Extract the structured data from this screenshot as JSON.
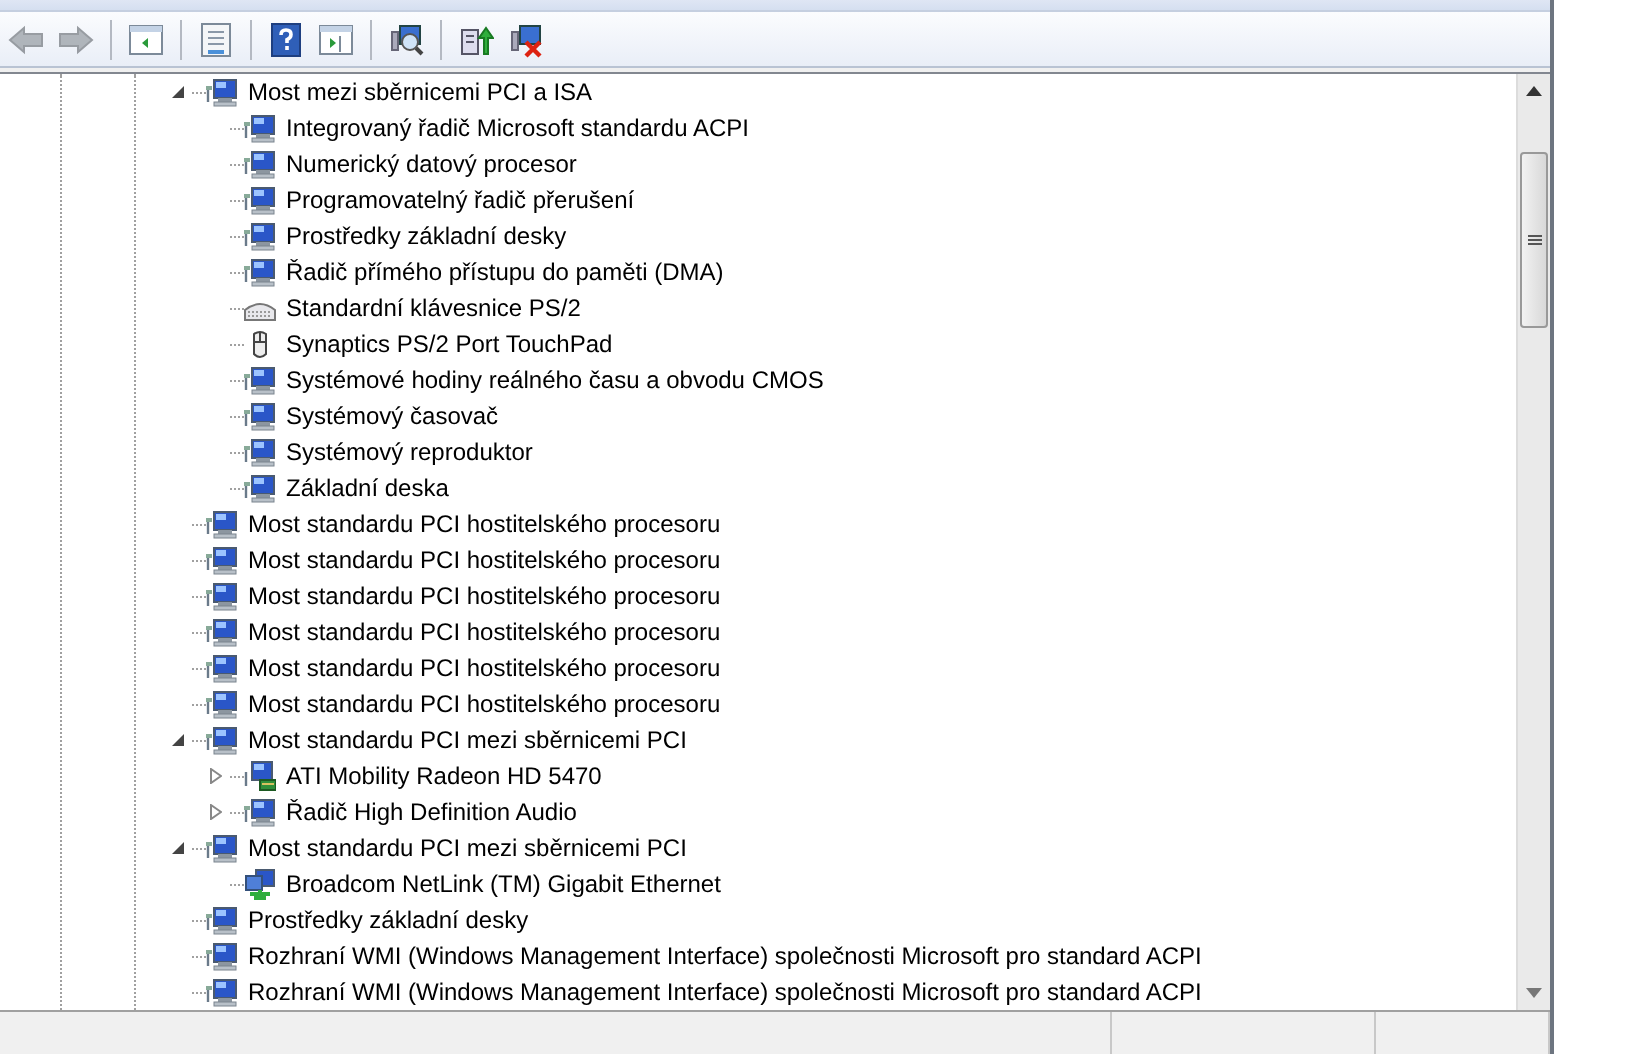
{
  "toolbar": {
    "buttons": [
      {
        "kind": "back",
        "disabled": true
      },
      {
        "kind": "forward",
        "disabled": true
      },
      {
        "kind": "sep"
      },
      {
        "kind": "pane",
        "disabled": false
      },
      {
        "kind": "sep"
      },
      {
        "kind": "properties",
        "disabled": false
      },
      {
        "kind": "sep"
      },
      {
        "kind": "help",
        "disabled": false
      },
      {
        "kind": "pane2",
        "disabled": false
      },
      {
        "kind": "sep"
      },
      {
        "kind": "scan",
        "disabled": false
      },
      {
        "kind": "sep"
      },
      {
        "kind": "update",
        "disabled": false
      },
      {
        "kind": "uninstall",
        "disabled": false
      }
    ]
  },
  "tree": [
    {
      "label": "Most mezi sběrnicemi PCI a ISA",
      "kind": "device",
      "expanded": true,
      "children": [
        {
          "label": "Integrovaný řadič Microsoft standardu ACPI",
          "kind": "device"
        },
        {
          "label": "Numerický datový procesor",
          "kind": "device"
        },
        {
          "label": "Programovatelný řadič přerušení",
          "kind": "device"
        },
        {
          "label": "Prostředky základní desky",
          "kind": "device"
        },
        {
          "label": "Řadič přímého přístupu do paměti (DMA)",
          "kind": "device"
        },
        {
          "label": "Standardní klávesnice PS/2",
          "kind": "keyboard"
        },
        {
          "label": "Synaptics PS/2 Port TouchPad",
          "kind": "mouse"
        },
        {
          "label": "Systémové hodiny reálného času a obvodu CMOS",
          "kind": "device"
        },
        {
          "label": "Systémový časovač",
          "kind": "device"
        },
        {
          "label": "Systémový reproduktor",
          "kind": "device"
        },
        {
          "label": "Základní deska",
          "kind": "device"
        }
      ]
    },
    {
      "label": "Most standardu PCI hostitelského procesoru",
      "kind": "device"
    },
    {
      "label": "Most standardu PCI hostitelského procesoru",
      "kind": "device"
    },
    {
      "label": "Most standardu PCI hostitelského procesoru",
      "kind": "device"
    },
    {
      "label": "Most standardu PCI hostitelského procesoru",
      "kind": "device"
    },
    {
      "label": "Most standardu PCI hostitelského procesoru",
      "kind": "device"
    },
    {
      "label": "Most standardu PCI hostitelského procesoru",
      "kind": "device"
    },
    {
      "label": "Most standardu PCI mezi sběrnicemi PCI",
      "kind": "device",
      "expanded": true,
      "children": [
        {
          "label": "ATI Mobility Radeon HD 5470",
          "kind": "display",
          "expanded": false
        },
        {
          "label": "Řadič High Definition Audio",
          "kind": "device",
          "expanded": false
        }
      ]
    },
    {
      "label": "Most standardu PCI mezi sběrnicemi PCI",
      "kind": "device",
      "expanded": true,
      "children": [
        {
          "label": "Broadcom NetLink (TM) Gigabit Ethernet",
          "kind": "network"
        }
      ]
    },
    {
      "label": "Prostředky základní desky",
      "kind": "device"
    },
    {
      "label": "Rozhraní WMI (Windows Management Interface) společnosti Microsoft pro standard ACPI",
      "kind": "device"
    },
    {
      "label": "Rozhraní WMI (Windows Management Interface) společnosti Microsoft pro standard ACPI",
      "kind": "device"
    }
  ]
}
